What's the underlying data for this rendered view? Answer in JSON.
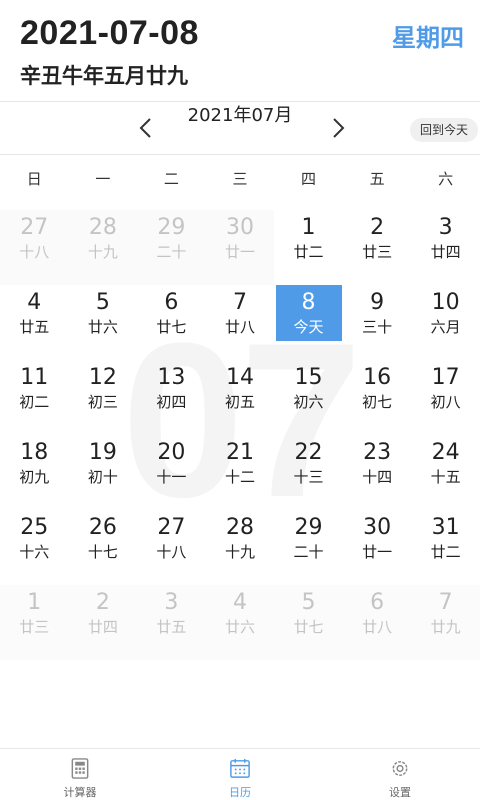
{
  "header": {
    "date": "2021-07-08",
    "lunar": "辛丑牛年五月廿九",
    "weekday": "星期四"
  },
  "nav": {
    "month_title": "2021年07月",
    "today_button": "回到今天",
    "prev_icon": "chevron-left-icon",
    "next_icon": "chevron-right-icon"
  },
  "weekdays": [
    "日",
    "一",
    "二",
    "三",
    "四",
    "五",
    "六"
  ],
  "watermark": "07",
  "days": [
    {
      "n": "27",
      "l": "十八",
      "out": true
    },
    {
      "n": "28",
      "l": "十九",
      "out": true
    },
    {
      "n": "29",
      "l": "二十",
      "out": true
    },
    {
      "n": "30",
      "l": "廿一",
      "out": true
    },
    {
      "n": "1",
      "l": "廿二"
    },
    {
      "n": "2",
      "l": "廿三"
    },
    {
      "n": "3",
      "l": "廿四"
    },
    {
      "n": "4",
      "l": "廿五"
    },
    {
      "n": "5",
      "l": "廿六"
    },
    {
      "n": "6",
      "l": "廿七"
    },
    {
      "n": "7",
      "l": "廿八"
    },
    {
      "n": "8",
      "l": "今天",
      "today": true
    },
    {
      "n": "9",
      "l": "三十"
    },
    {
      "n": "10",
      "l": "六月"
    },
    {
      "n": "11",
      "l": "初二"
    },
    {
      "n": "12",
      "l": "初三"
    },
    {
      "n": "13",
      "l": "初四"
    },
    {
      "n": "14",
      "l": "初五"
    },
    {
      "n": "15",
      "l": "初六"
    },
    {
      "n": "16",
      "l": "初七"
    },
    {
      "n": "17",
      "l": "初八"
    },
    {
      "n": "18",
      "l": "初九"
    },
    {
      "n": "19",
      "l": "初十"
    },
    {
      "n": "20",
      "l": "十一"
    },
    {
      "n": "21",
      "l": "十二"
    },
    {
      "n": "22",
      "l": "十三"
    },
    {
      "n": "23",
      "l": "十四"
    },
    {
      "n": "24",
      "l": "十五"
    },
    {
      "n": "25",
      "l": "十六"
    },
    {
      "n": "26",
      "l": "十七"
    },
    {
      "n": "27",
      "l": "十八"
    },
    {
      "n": "28",
      "l": "十九"
    },
    {
      "n": "29",
      "l": "二十"
    },
    {
      "n": "30",
      "l": "廿一"
    },
    {
      "n": "31",
      "l": "廿二"
    },
    {
      "n": "1",
      "l": "廿三",
      "out": true
    },
    {
      "n": "2",
      "l": "廿四",
      "out": true
    },
    {
      "n": "3",
      "l": "廿五",
      "out": true
    },
    {
      "n": "4",
      "l": "廿六",
      "out": true
    },
    {
      "n": "5",
      "l": "廿七",
      "out": true
    },
    {
      "n": "6",
      "l": "廿八",
      "out": true
    },
    {
      "n": "7",
      "l": "廿九",
      "out": true
    }
  ],
  "tabs": [
    {
      "label": "计算器",
      "icon": "calculator-icon",
      "active": false
    },
    {
      "label": "日历",
      "icon": "calendar-icon",
      "active": true
    },
    {
      "label": "设置",
      "icon": "gear-icon",
      "active": false
    }
  ],
  "colors": {
    "accent": "#4f9be8",
    "muted_text": "#c4c4c4"
  }
}
